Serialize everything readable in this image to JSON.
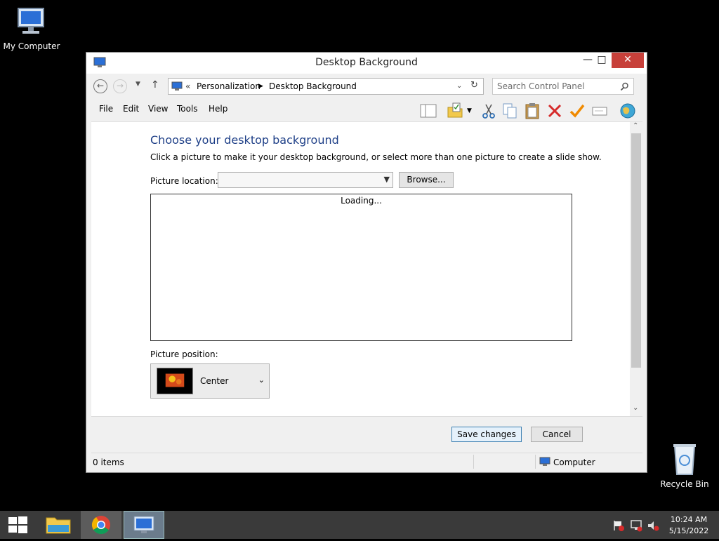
{
  "desktop": {
    "icons": [
      {
        "label": "My Computer"
      },
      {
        "label": "Recycle Bin"
      }
    ]
  },
  "window": {
    "title": "Desktop Background",
    "controls": {
      "minimize": "—",
      "maximize": "□",
      "close": "✕"
    },
    "nav": {
      "back": "←",
      "forward": "→",
      "up": "↑",
      "breadcrumb_prefix": "«",
      "breadcrumb": [
        "Personalization",
        "Desktop Background"
      ],
      "search_placeholder": "Search Control Panel"
    },
    "menu": [
      "File",
      "Edit",
      "View",
      "Tools",
      "Help"
    ],
    "content": {
      "heading": "Choose your desktop background",
      "description": "Click a picture to make it your desktop background, or select more than one picture to create a slide show.",
      "picture_location_label": "Picture location:",
      "picture_location_value": "",
      "browse_label": "Browse...",
      "loading_text": "Loading...",
      "picture_position_label": "Picture position:",
      "picture_position_value": "Center"
    },
    "footer": {
      "save_label": "Save changes",
      "cancel_label": "Cancel"
    },
    "status": {
      "items": "0 items",
      "zone": "Computer"
    }
  },
  "taskbar": {
    "time": "10:24 AM",
    "date": "5/15/2022"
  },
  "colors": {
    "heading": "#1e3f87",
    "close_button": "#c7403a",
    "taskbar": "#3a3a3a"
  }
}
